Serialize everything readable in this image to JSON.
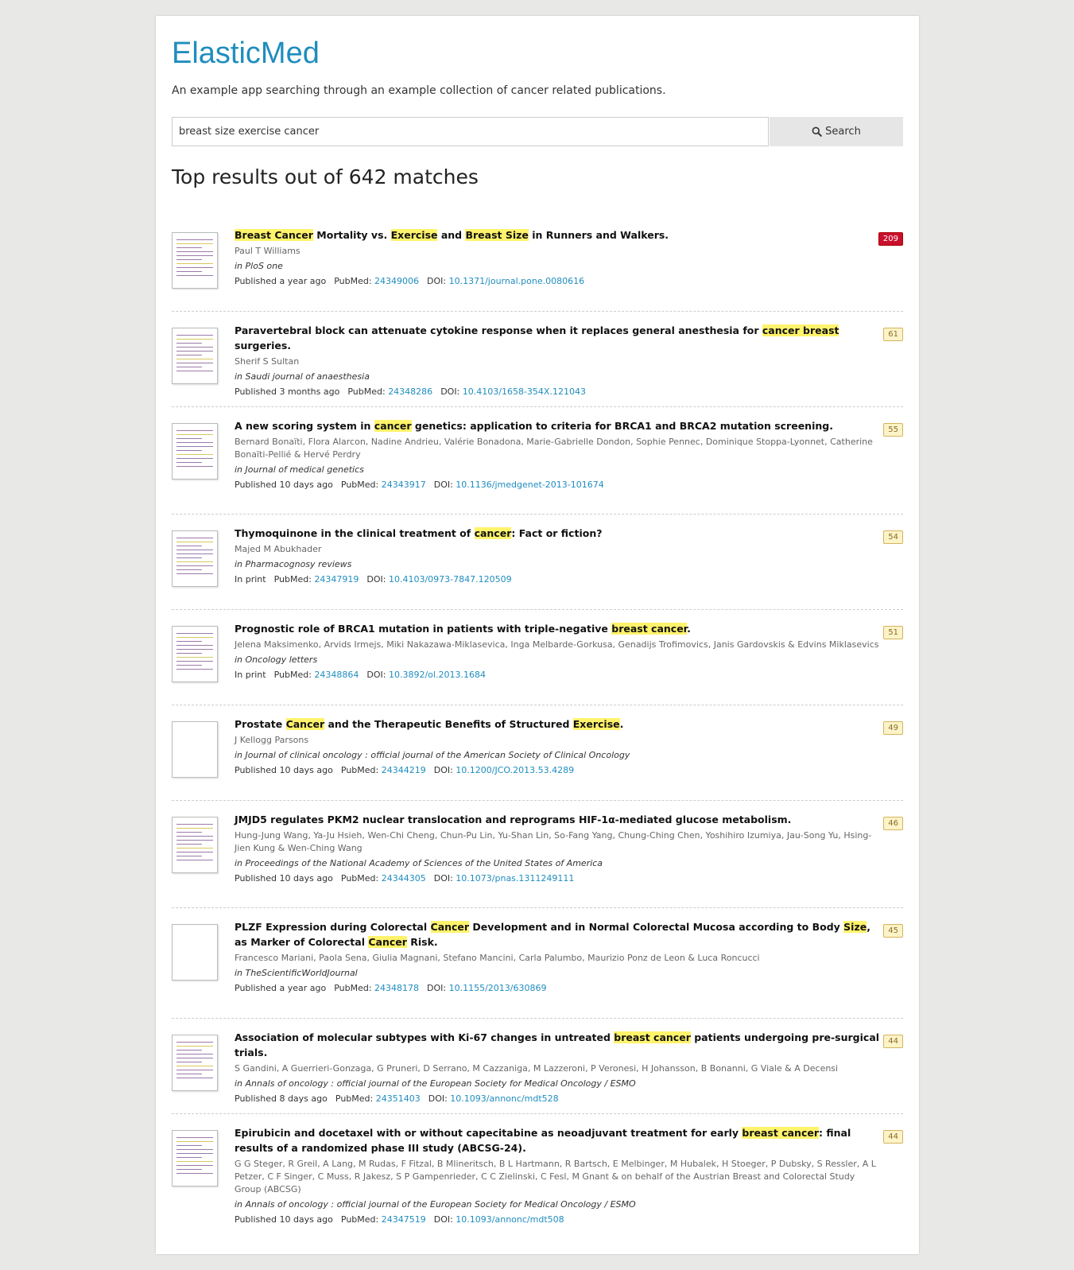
{
  "header": {
    "brand": "ElasticMed",
    "tagline": "An example app searching through an example collection of cancer related publications."
  },
  "search": {
    "query": "breast size exercise cancer",
    "button_label": "Search"
  },
  "results_heading": "Top results out of 642 matches",
  "labels": {
    "pubmed": "PubMed:",
    "doi": "DOI:"
  },
  "results": [
    {
      "title": [
        {
          "t": "Breast Cancer",
          "h": true
        },
        {
          "t": " Mortality vs. ",
          "h": false
        },
        {
          "t": "Exercise",
          "h": true
        },
        {
          "t": " and ",
          "h": false
        },
        {
          "t": "Breast Size",
          "h": true
        },
        {
          "t": " in Runners and Walkers.",
          "h": false
        }
      ],
      "authors": "Paul T Williams",
      "journal": "in PloS one",
      "published": "Published a year ago",
      "pubmed": "24349006",
      "doi": "10.1371/journal.pone.0080616",
      "score": "209",
      "top": true
    },
    {
      "title": [
        {
          "t": "Paravertebral block can attenuate cytokine response when it replaces general anesthesia for ",
          "h": false
        },
        {
          "t": "cancer breast",
          "h": true
        },
        {
          "t": " surgeries.",
          "h": false
        }
      ],
      "authors": "Sherif S Sultan",
      "journal": "in Saudi journal of anaesthesia",
      "published": "Published 3 months ago",
      "pubmed": "24348286",
      "doi": "10.4103/1658-354X.121043",
      "score": "61"
    },
    {
      "title": [
        {
          "t": "A new scoring system in ",
          "h": false
        },
        {
          "t": "cancer",
          "h": true
        },
        {
          "t": " genetics: application to criteria for BRCA1 and BRCA2 mutation screening.",
          "h": false
        }
      ],
      "authors": "Bernard Bonaïti, Flora Alarcon, Nadine Andrieu, Valérie Bonadona, Marie-Gabrielle Dondon, Sophie Pennec, Dominique Stoppa-Lyonnet, Catherine Bonaïti-Pellié & Hervé Perdry",
      "journal": "in Journal of medical genetics",
      "published": "Published 10 days ago",
      "pubmed": "24343917",
      "doi": "10.1136/jmedgenet-2013-101674",
      "score": "55"
    },
    {
      "title": [
        {
          "t": "Thymoquinone in the clinical treatment of ",
          "h": false
        },
        {
          "t": "cancer",
          "h": true
        },
        {
          "t": ": Fact or fiction?",
          "h": false
        }
      ],
      "authors": "Majed M Abukhader",
      "journal": "in Pharmacognosy reviews",
      "published": "In print",
      "pubmed": "24347919",
      "doi": "10.4103/0973-7847.120509",
      "score": "54"
    },
    {
      "title": [
        {
          "t": "Prognostic role of BRCA1 mutation in patients with triple-negative ",
          "h": false
        },
        {
          "t": "breast cancer",
          "h": true
        },
        {
          "t": ".",
          "h": false
        }
      ],
      "authors": "Jelena Maksimenko, Arvids Irmejs, Miki Nakazawa-Miklasevica, Inga Melbarde-Gorkusa, Genadijs Trofimovics, Janis Gardovskis & Edvins Miklasevics",
      "journal": "in Oncology letters",
      "published": "In print",
      "pubmed": "24348864",
      "doi": "10.3892/ol.2013.1684",
      "score": "51"
    },
    {
      "title": [
        {
          "t": "Prostate ",
          "h": false
        },
        {
          "t": "Cancer",
          "h": true
        },
        {
          "t": " and the Therapeutic Benefits of Structured ",
          "h": false
        },
        {
          "t": "Exercise",
          "h": true
        },
        {
          "t": ".",
          "h": false
        }
      ],
      "authors": "J Kellogg Parsons",
      "journal": "in Journal of clinical oncology : official journal of the American Society of Clinical Oncology",
      "published": "Published 10 days ago",
      "pubmed": "24344219",
      "doi": "10.1200/JCO.2013.53.4289",
      "score": "49",
      "blank_thumb": true
    },
    {
      "title": [
        {
          "t": "JMJD5 regulates PKM2 nuclear translocation and reprograms HIF-1α-mediated glucose metabolism.",
          "h": false
        }
      ],
      "authors": "Hung-Jung Wang, Ya-Ju Hsieh, Wen-Chi Cheng, Chun-Pu Lin, Yu-Shan Lin, So-Fang Yang, Chung-Ching Chen, Yoshihiro Izumiya, Jau-Song Yu, Hsing-Jien Kung & Wen-Ching Wang",
      "journal": "in Proceedings of the National Academy of Sciences of the United States of America",
      "published": "Published 10 days ago",
      "pubmed": "24344305",
      "doi": "10.1073/pnas.1311249111",
      "score": "46"
    },
    {
      "title": [
        {
          "t": "PLZF Expression during Colorectal ",
          "h": false
        },
        {
          "t": "Cancer",
          "h": true
        },
        {
          "t": " Development and in Normal Colorectal Mucosa according to Body ",
          "h": false
        },
        {
          "t": "Size",
          "h": true
        },
        {
          "t": ", as Marker of Colorectal ",
          "h": false
        },
        {
          "t": "Cancer",
          "h": true
        },
        {
          "t": " Risk.",
          "h": false
        }
      ],
      "authors": "Francesco Mariani, Paola Sena, Giulia Magnani, Stefano Mancini, Carla Palumbo, Maurizio Ponz de Leon & Luca Roncucci",
      "journal": "in TheScientificWorldJournal",
      "published": "Published a year ago",
      "pubmed": "24348178",
      "doi": "10.1155/2013/630869",
      "score": "45",
      "blank_thumb": true
    },
    {
      "title": [
        {
          "t": "Association of molecular subtypes with Ki-67 changes in untreated ",
          "h": false
        },
        {
          "t": "breast cancer",
          "h": true
        },
        {
          "t": " patients undergoing pre-surgical trials.",
          "h": false
        }
      ],
      "authors": "S Gandini, A Guerrieri-Gonzaga, G Pruneri, D Serrano, M Cazzaniga, M Lazzeroni, P Veronesi, H Johansson, B Bonanni, G Viale & A Decensi",
      "journal": "in Annals of oncology : official journal of the European Society for Medical Oncology / ESMO",
      "published": "Published 8 days ago",
      "pubmed": "24351403",
      "doi": "10.1093/annonc/mdt528",
      "score": "44"
    },
    {
      "title": [
        {
          "t": "Epirubicin and docetaxel with or without capecitabine as neoadjuvant treatment for early ",
          "h": false
        },
        {
          "t": "breast cancer",
          "h": true
        },
        {
          "t": ": final results of a randomized phase III study (ABCSG-24).",
          "h": false
        }
      ],
      "authors": "G G Steger, R Greil, A Lang, M Rudas, F Fitzal, B Mlineritsch, B L Hartmann, R Bartsch, E Melbinger, M Hubalek, H Stoeger, P Dubsky, S Ressler, A L Petzer, C F Singer, C Muss, R Jakesz, S P Gampenrieder, C C Zielinski, C Fesl, M Gnant & on behalf of the Austrian Breast and Colorectal Study Group (ABCSG)",
      "journal": "in Annals of oncology : official journal of the European Society for Medical Oncology / ESMO",
      "published": "Published 10 days ago",
      "pubmed": "24347519",
      "doi": "10.1093/annonc/mdt508",
      "score": "44"
    }
  ]
}
